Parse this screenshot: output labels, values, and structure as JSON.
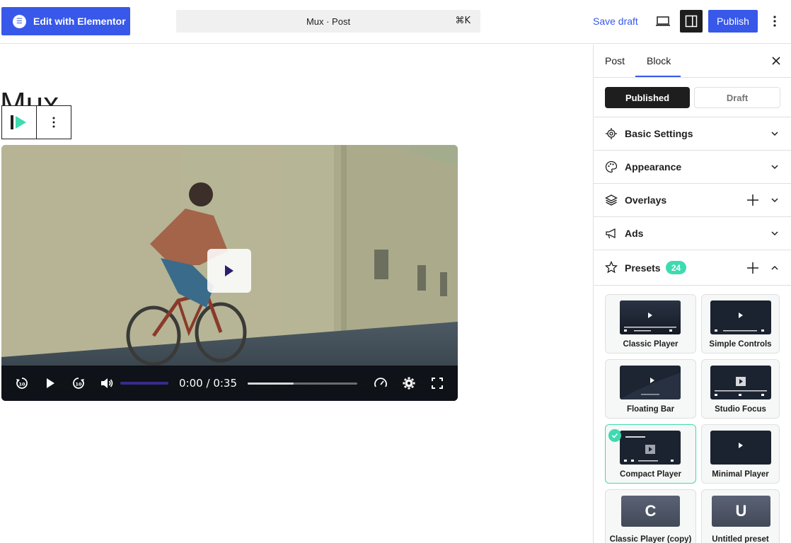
{
  "header": {
    "elementor_label": "Edit with Elementor",
    "command_bar": "Mux · Post",
    "shortcut": "⌘K",
    "save_draft": "Save draft",
    "publish": "Publish"
  },
  "canvas": {
    "post_title": "Mux",
    "video": {
      "time_current": "0:00",
      "time_separator": "/",
      "time_total": "0:35",
      "volume_level": 1.0,
      "progress": 0.42
    }
  },
  "sidebar": {
    "tabs": [
      {
        "label": "Post"
      },
      {
        "label": "Block"
      }
    ],
    "active_tab": "Block",
    "status_options": [
      {
        "label": "Published"
      },
      {
        "label": "Draft"
      }
    ],
    "status_selected": "Published",
    "panels": [
      {
        "label": "Basic Settings",
        "icon": "gear-icon"
      },
      {
        "label": "Appearance",
        "icon": "palette-icon"
      },
      {
        "label": "Overlays",
        "icon": "layers-icon"
      },
      {
        "label": "Ads",
        "icon": "megaphone-icon"
      },
      {
        "label": "Presets",
        "icon": "star-icon",
        "badge": "24"
      }
    ],
    "presets": [
      {
        "name": "Classic Player"
      },
      {
        "name": "Simple Controls"
      },
      {
        "name": "Floating Bar"
      },
      {
        "name": "Studio Focus"
      },
      {
        "name": "Compact Player",
        "selected": true
      },
      {
        "name": "Minimal Player"
      },
      {
        "name": "Classic Player (copy)",
        "letter": "C"
      },
      {
        "name": "Untitled preset",
        "letter": "U"
      }
    ]
  },
  "colors": {
    "accent": "#3858e9",
    "dark": "#1e1e1e",
    "teal": "#3ddbb0"
  }
}
